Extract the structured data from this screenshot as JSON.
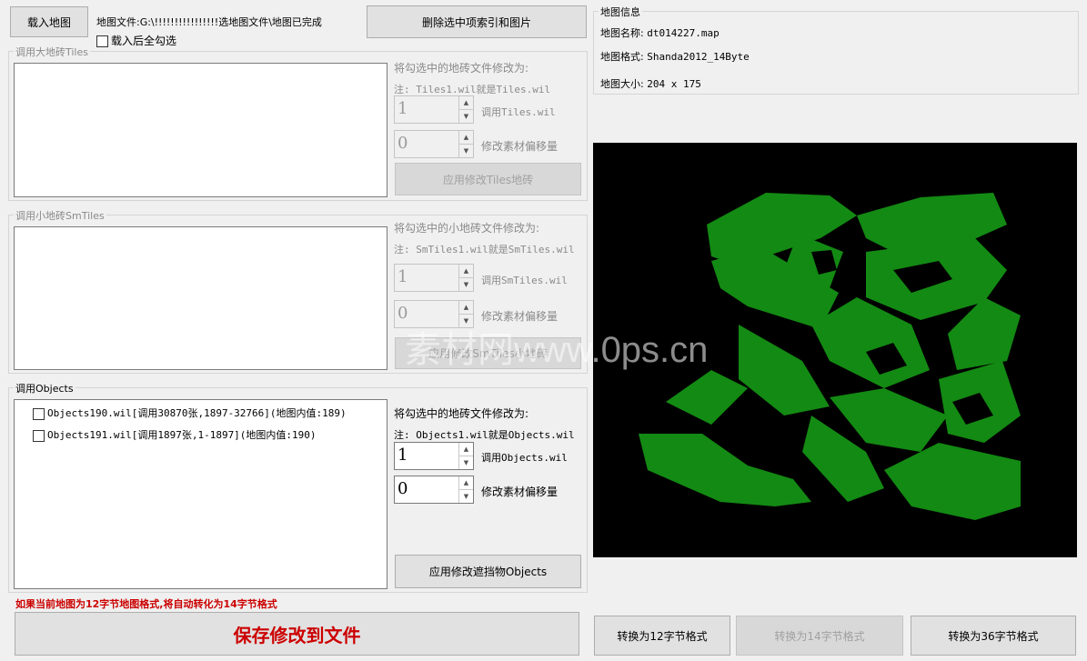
{
  "top": {
    "load_button": "载入地图",
    "map_file_text": "地图文件:G:\\!!!!!!!!!!!!!!!!选地图文件\\地图已完成",
    "delete_button": "删除选中项索引和图片",
    "select_all_label": "载入后全勾选"
  },
  "tiles_group": {
    "title": "调用大地砖Tiles",
    "change_to": "将勾选中的地砖文件修改为:",
    "note": "注: Tiles1.wil就是Tiles.wil",
    "spin1": "1",
    "spin1_label": "调用Tiles.wil",
    "spin2": "0",
    "spin2_label": "修改素材偏移量",
    "apply_button": "应用修改Tiles地砖"
  },
  "smtiles_group": {
    "title": "调用小地砖SmTiles",
    "change_to": "将勾选中的小地砖文件修改为:",
    "note": "注: SmTiles1.wil就是SmTiles.wil",
    "spin1": "1",
    "spin1_label": "调用SmTiles.wil",
    "spin2": "0",
    "spin2_label": "修改素材偏移量",
    "apply_button": "应用修改SmTiles小地砖"
  },
  "objects_group": {
    "title": "调用Objects",
    "items": [
      "Objects190.wil[调用30870张,1897-32766](地图内值:189)",
      "Objects191.wil[调用1897张,1-1897](地图内值:190)"
    ],
    "change_to": "将勾选中的地砖文件修改为:",
    "note": "注: Objects1.wil就是Objects.wil",
    "spin1": "1",
    "spin1_label": "调用Objects.wil",
    "spin2": "0",
    "spin2_label": "修改素材偏移量",
    "apply_button": "应用修改遮挡物Objects"
  },
  "warning": "如果当前地图为12字节地图格式,将自动转化为14字节格式",
  "save_button": "保存修改到文件",
  "map_info": {
    "title": "地图信息",
    "name_label": "地图名称:",
    "name_value": "dt014227.map",
    "format_label": "地图格式:",
    "format_value": "Shanda2012_14Byte",
    "size_label": "地图大小:",
    "size_value": "204 x 175"
  },
  "convert": {
    "to12": "转换为12字节格式",
    "to14": "转换为14字节格式",
    "to36": "转换为36字节格式"
  },
  "watermark": "素材网www.0ps.cn",
  "colors": {
    "map_bg": "#000000",
    "map_fill": "#138a13",
    "warning": "#cc0000",
    "save_text": "#cc0000"
  }
}
